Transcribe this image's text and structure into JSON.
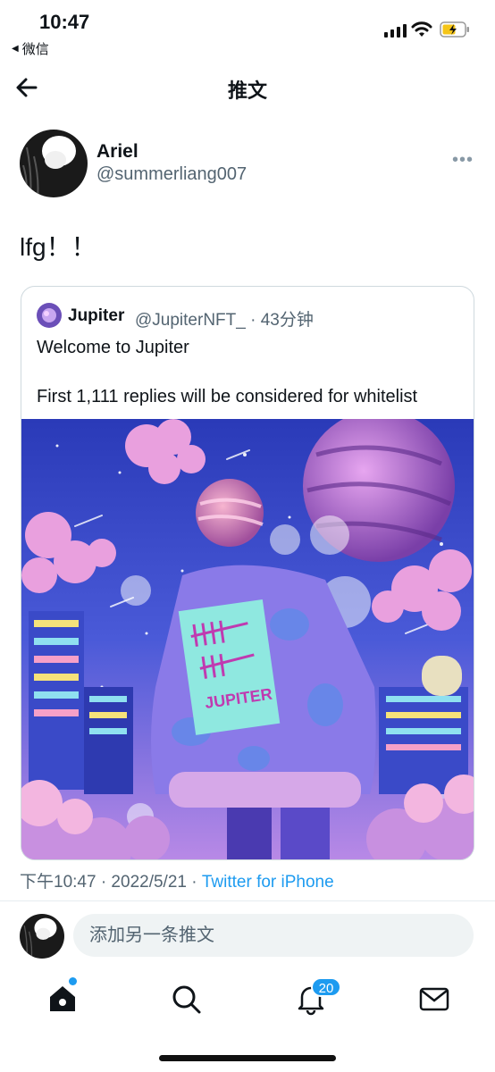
{
  "status_bar": {
    "time": "10:47",
    "back_app": "微信"
  },
  "nav": {
    "title": "推文"
  },
  "tweet": {
    "author_name": "Ariel",
    "author_handle": "@summerliang007",
    "text": "lfg！！",
    "meta_date": "下午10:47 · 2022/5/21 · ",
    "meta_source": "Twitter for iPhone"
  },
  "quoted": {
    "author_name": "Jupiter",
    "author_meta": "@JupiterNFT_ · 43分钟",
    "line1": "Welcome to Jupiter",
    "line2": "First 1,111 replies will be considered for whitelist",
    "image_text": "JUPITER"
  },
  "compose": {
    "placeholder": "添加另一条推文"
  },
  "tabs": {
    "notifications_count": "20"
  },
  "colors": {
    "accent": "#1d9bf0",
    "muted": "#536471",
    "text": "#0f1419"
  },
  "icons": [
    "back-arrow-icon",
    "more-icon",
    "home-icon",
    "search-icon",
    "bell-icon",
    "mail-icon",
    "wifi-icon",
    "battery-icon",
    "signal-icon"
  ]
}
